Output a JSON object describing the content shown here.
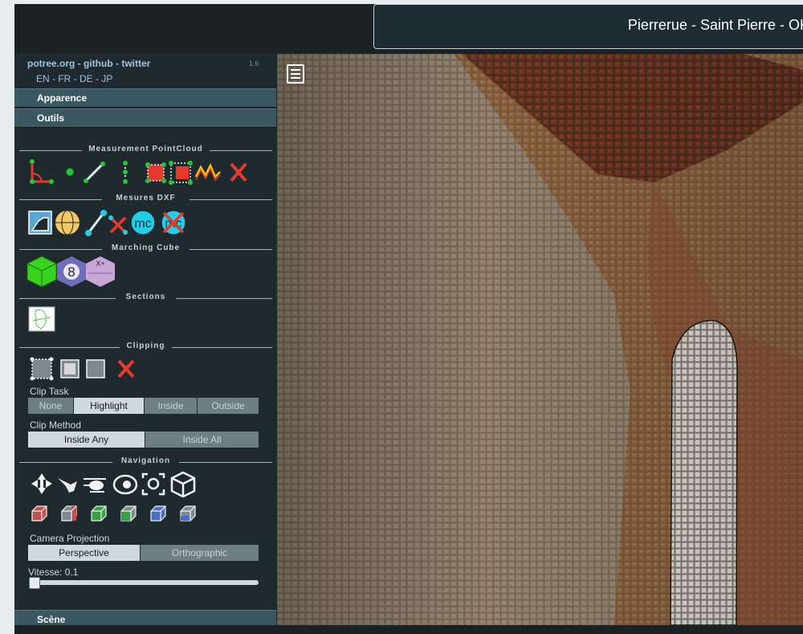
{
  "title": "Pierrerue - Saint Pierre - OK",
  "sidebar": {
    "links": {
      "potree": "potree.org",
      "sep1": " - ",
      "github": "github",
      "sep2": " - ",
      "twitter": "twitter"
    },
    "version": "1.6",
    "languages": "EN - FR - DE - JP",
    "menus": {
      "apparence": "Apparence",
      "outils": "Outils",
      "scene": "Scène"
    },
    "sections": {
      "measurement": "Measurement PointCloud",
      "dxf": "Mesures DXF",
      "marching": "Marching Cube",
      "sections": "Sections",
      "clipping": "Clipping",
      "navigation": "Navigation"
    },
    "clip_task": {
      "label": "Clip Task",
      "options": [
        "None",
        "Highlight",
        "Inside",
        "Outside"
      ],
      "selected": "Highlight"
    },
    "clip_method": {
      "label": "Clip Method",
      "options": [
        "Inside Any",
        "Inside All"
      ],
      "selected": "Inside Any"
    },
    "camera_projection": {
      "label": "Camera Projection",
      "options": [
        "Perspective",
        "Orthographic"
      ],
      "selected": "Perspective"
    },
    "speed": {
      "label": "Vitesse: 0.1",
      "value": 0.1
    },
    "marching_icon_text": {
      "eight": "8",
      "xplus": "X+"
    },
    "dxf_icon_text": {
      "mc": "mc"
    }
  },
  "icons": {
    "measurement": [
      "angle-icon",
      "point-icon",
      "distance-icon",
      "height-icon",
      "area-icon",
      "volume-icon",
      "profile-icon",
      "remove-all-icon"
    ],
    "dxf": [
      "dxf-area-icon",
      "dxf-sphere-icon",
      "dxf-distance-icon",
      "dxf-remove-icon",
      "marching-cube-icon",
      "marching-cube-remove-icon"
    ],
    "navigation": [
      "earth-controls-icon",
      "fly-controls-icon",
      "helicopter-controls-icon",
      "orbit-controls-icon",
      "focus-icon",
      "navigation-cube-icon"
    ],
    "views": [
      "left-view-icon",
      "front-view-icon",
      "top-view-icon",
      "right-view-icon",
      "back-view-icon",
      "bottom-view-icon"
    ]
  },
  "colors": {
    "accent": "#3b5762",
    "sidebar": "#1f2a2e",
    "selected": "#cfd8dc",
    "unselected": "#6d7e85",
    "link": "#9fc3e1"
  }
}
